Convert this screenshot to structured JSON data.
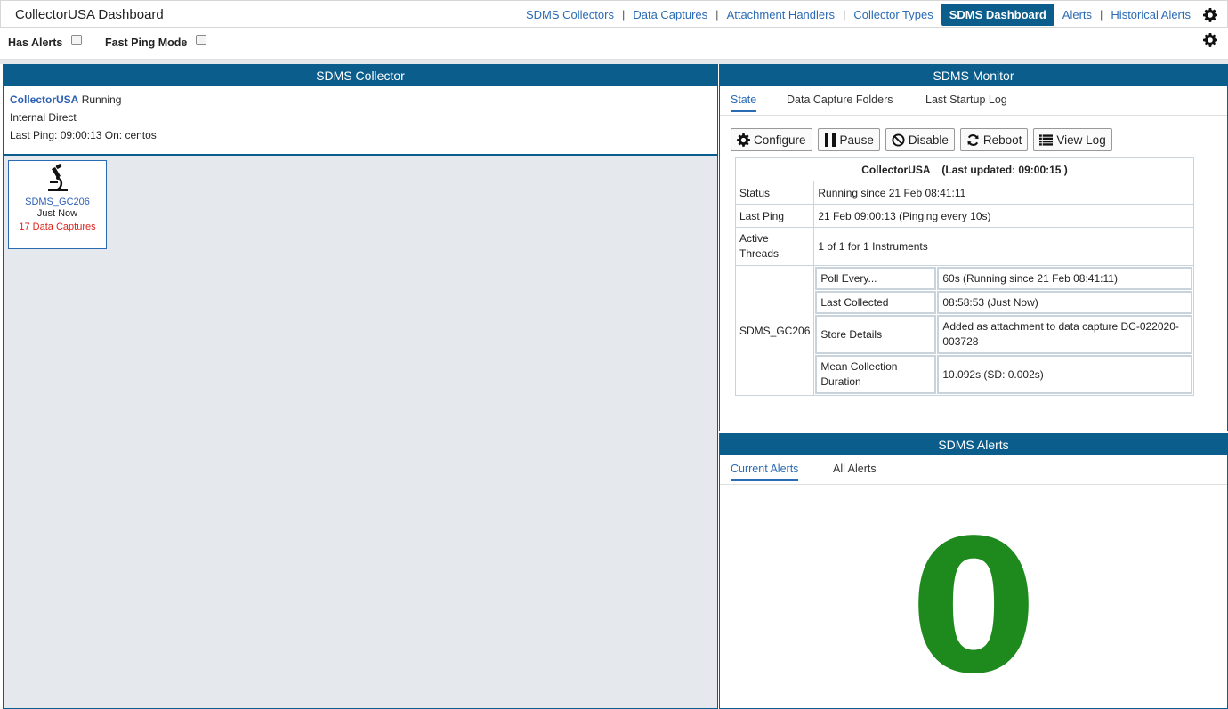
{
  "app": {
    "title": "CollectorUSA Dashboard"
  },
  "nav": {
    "items": [
      {
        "label": "SDMS Collectors"
      },
      {
        "label": "Data Captures"
      },
      {
        "label": "Attachment Handlers"
      },
      {
        "label": "Collector Types"
      },
      {
        "label": "SDMS Dashboard"
      },
      {
        "label": "Alerts"
      },
      {
        "label": "Historical Alerts"
      }
    ],
    "separator": "|",
    "active": "SDMS Dashboard"
  },
  "filters": {
    "has_alerts": {
      "label": "Has Alerts",
      "checked": false
    },
    "fast_ping": {
      "label": "Fast Ping Mode",
      "checked": false
    }
  },
  "collector_panel": {
    "title": "SDMS Collector",
    "collector": {
      "name": "CollectorUSA",
      "state": "Running",
      "type": "Internal",
      "mode": "Direct",
      "last_ping": "Last Ping: 09:00:13",
      "host": "On: centos"
    },
    "instrument": {
      "icon": "microscope-icon",
      "name": "SDMS_GC206",
      "status": "Just Now",
      "captures": "17 Data Captures"
    }
  },
  "monitor_panel": {
    "title": "SDMS Monitor",
    "tabs": [
      "State",
      "Data Capture Folders",
      "Last Startup Log"
    ],
    "active_tab": "State",
    "buttons": {
      "configure": "Configure",
      "pause": "Pause",
      "disable": "Disable",
      "reboot": "Reboot",
      "view_log": "View Log"
    },
    "table": {
      "header": "CollectorUSA    (Last updated: 09:00:15 )",
      "rows": {
        "status": {
          "label": "Status",
          "value": "Running since 21 Feb 08:41:11"
        },
        "last_ping": {
          "label": "Last Ping",
          "value": "21 Feb 09:00:13 (Pinging every 10s)"
        },
        "threads": {
          "label": "Active Threads",
          "value": "1 of 1 for 1 Instruments"
        }
      },
      "instrument": {
        "name": "SDMS_GC206",
        "rows": {
          "poll": {
            "label": "Poll Every...",
            "value": "60s (Running since 21 Feb 08:41:11)"
          },
          "collected": {
            "label": "Last Collected",
            "value": "08:58:53 (Just Now)"
          },
          "store": {
            "label": "Store Details",
            "value": "Added as attachment to data capture DC-022020-003728"
          },
          "duration": {
            "label": "Mean Collection Duration",
            "value": "10.092s (SD: 0.002s)"
          }
        }
      }
    }
  },
  "alerts_panel": {
    "title": "SDMS Alerts",
    "tabs": [
      "Current Alerts",
      "All Alerts"
    ],
    "active_tab": "Current Alerts",
    "count": "0",
    "count_color": "#1e8a1e"
  },
  "colors": {
    "header": "#0b5d8c",
    "link": "#2b6bb4",
    "alert_red": "#e0231c"
  }
}
